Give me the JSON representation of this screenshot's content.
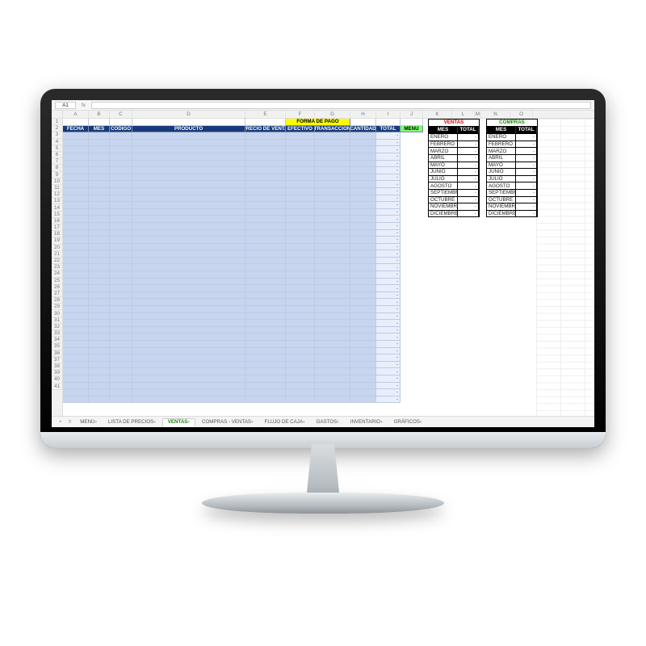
{
  "name_box": "A1",
  "column_letters": [
    "A",
    "B",
    "C",
    "D",
    "E",
    "F",
    "G",
    "H",
    "I",
    "J",
    "K",
    "L",
    "M",
    "N",
    "O"
  ],
  "row_count": 41,
  "header": {
    "forma_pago": "FORMA DE PAGO",
    "cols": {
      "fecha": "FECHA",
      "mes": "MES",
      "codigo": "CODIGO",
      "producto": "PRODUCTO",
      "precio": "PRECIO DE VENTA",
      "efectivo": "EFECTIVO",
      "transaccion": "TRANSACCIÓN",
      "cantidad": "CANTIDAD",
      "total": "TOTAL",
      "menu": "MENU"
    }
  },
  "data_row_count": 39,
  "total_placeholder": "-",
  "side": {
    "ventas": {
      "title": "VENTAS",
      "mes": "MES",
      "total": "TOTAL"
    },
    "compras": {
      "title": "COMPRAS",
      "mes": "MES",
      "total": "TOTAL"
    },
    "months": [
      "ENERO",
      "FEBRERO",
      "MARZO",
      "ABRIL",
      "MAYO",
      "JUNIO",
      "JULIO",
      "AGOSTO",
      "SEPTIEMBRE",
      "OCTUBRE",
      "NOVIEMBRE",
      "DICIEMBRE"
    ]
  },
  "tabs": {
    "items": [
      "MENU",
      "LISTA DE PRECIOS",
      "VENTAS",
      "COMPRAS - VENTAS",
      "FLUJO DE CAJA",
      "GASTOS",
      "INVENTARIO",
      "GRÁFICOS"
    ],
    "active_index": 2
  }
}
